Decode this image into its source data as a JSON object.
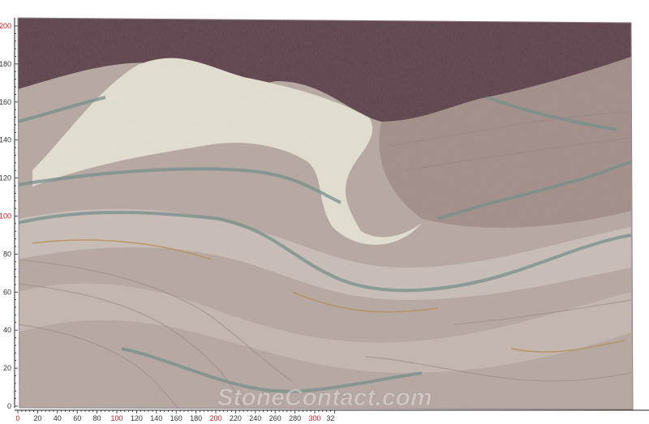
{
  "image": {
    "subject": "marble-slab",
    "colors": {
      "background": "#ffffff",
      "ruler_line": "#222222",
      "ruler_label": "#333333",
      "ruler_label_highlight": "#d11a1a",
      "slab_base": "#b6a7a0",
      "slab_dark_band": "#5b4049",
      "slab_white_vein": "#e4e0d2",
      "slab_green_vein": "#6f8c86",
      "slab_gold_vein": "#b88a4a"
    }
  },
  "ruler": {
    "vertical": {
      "labels": [
        "0",
        "20",
        "40",
        "60",
        "80",
        "100",
        "120",
        "140",
        "160",
        "180",
        "200"
      ],
      "highlight": [
        "100",
        "200"
      ]
    },
    "horizontal": {
      "labels": [
        "0",
        "20",
        "40",
        "60",
        "80",
        "100",
        "120",
        "140",
        "160",
        "180",
        "200",
        "220",
        "240",
        "260",
        "280",
        "300",
        "32"
      ],
      "highlight": [
        "0",
        "100",
        "200",
        "300"
      ]
    }
  },
  "watermark": {
    "text": "StoneContact.com"
  }
}
